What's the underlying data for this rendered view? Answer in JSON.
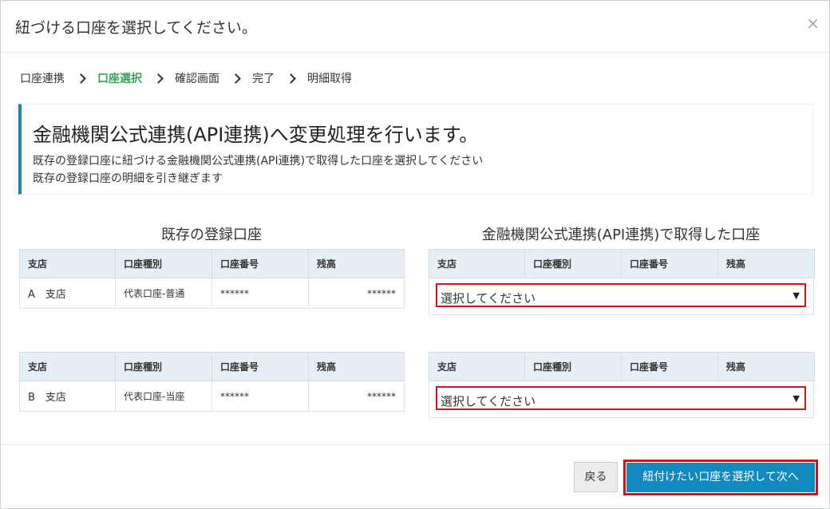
{
  "modal": {
    "title": "紐づける口座を選択してください。",
    "close_label": "×"
  },
  "steps": [
    "口座連携",
    "口座選択",
    "確認画面",
    "完了",
    "明細取得"
  ],
  "active_step": "口座選択",
  "notice": {
    "title": "金融機関公式連携(API連携)へ変更処理を行います。",
    "line1": "既存の登録口座に紐づける金融機関公式連携(API連携)で取得した口座を選択してください",
    "line2": "既存の登録口座の明細を引き継ぎます"
  },
  "left": {
    "heading": "既存の登録口座",
    "columns": [
      "支店",
      "口座種別",
      "口座番号",
      "残高"
    ],
    "rows": [
      {
        "branch": "A　支店",
        "type": "代表口座-普通",
        "number": "******",
        "balance": "******"
      },
      {
        "branch": "B　支店",
        "type": "代表口座-当座",
        "number": "******",
        "balance": "******"
      }
    ]
  },
  "right": {
    "heading": "金融機関公式連携(API連携)で取得した口座",
    "columns": [
      "支店",
      "口座種別",
      "口座番号",
      "残高"
    ],
    "select_placeholder": "選択してください",
    "select_arrow": "▼"
  },
  "footer": {
    "back_label": "戻る",
    "next_label": "紐付けたい口座を選択して次へ"
  },
  "colors": {
    "accent_green": "#3aa35b",
    "accent_blue": "#1289bf",
    "highlight_red": "#d0121b",
    "header_bg": "#e6eef6"
  }
}
